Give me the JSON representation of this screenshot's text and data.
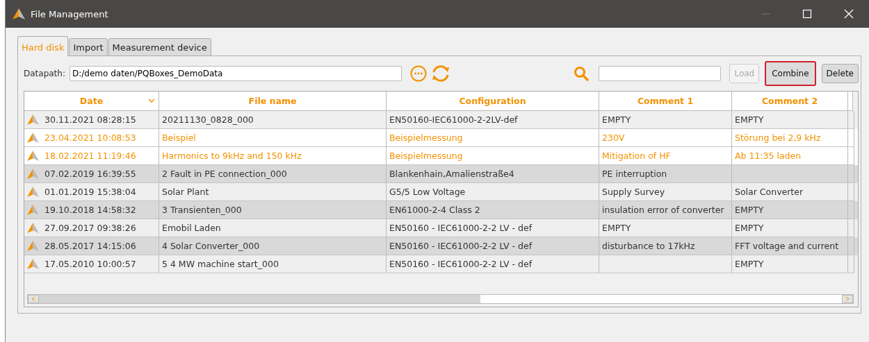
{
  "window": {
    "title": "File Management"
  },
  "tabs": [
    {
      "label": "Hard disk",
      "selected": true
    },
    {
      "label": "Import",
      "selected": false
    },
    {
      "label": "Measurement device",
      "selected": false
    }
  ],
  "datapath": {
    "label": "Datapath:",
    "value": "D:/demo daten/PQBoxes_DemoData"
  },
  "buttons": [
    {
      "label": "Load",
      "disabled": true,
      "highlighted": false
    },
    {
      "label": "Combine",
      "disabled": false,
      "highlighted": true
    },
    {
      "label": "Delete",
      "disabled": false,
      "highlighted": false
    }
  ],
  "table": {
    "columns": [
      {
        "label": "Date",
        "sorted": true
      },
      {
        "label": "File name",
        "sorted": false
      },
      {
        "label": "Configuration",
        "sorted": false
      },
      {
        "label": "Comment 1",
        "sorted": false
      },
      {
        "label": "Comment 2",
        "sorted": false
      }
    ],
    "rows": [
      {
        "selected": false,
        "cells": [
          "30.11.2021 08:28:15",
          "20211130_0828_000",
          "EN50160-IEC61000-2-2LV-def",
          "EMPTY",
          "EMPTY"
        ]
      },
      {
        "selected": true,
        "cells": [
          "23.04.2021 10:08:53",
          "Beispiel",
          "Beispielmessung",
          "230V",
          "Störung bei 2,9 kHz"
        ]
      },
      {
        "selected": true,
        "cells": [
          "18.02.2021 11:19:46",
          "Harmonics to 9kHz and 150 kHz",
          "Beispielmessung",
          "Mitigation of HF",
          "Ab 11:35 laden"
        ]
      },
      {
        "selected": false,
        "cells": [
          "07.02.2019 16:39:55",
          "2 Fault in PE connection_000",
          "Blankenhain,Amalienstraße4",
          "PE interruption",
          ""
        ]
      },
      {
        "selected": false,
        "cells": [
          "01.01.2019 15:38:04",
          "Solar Plant",
          "G5/5 Low Voltage",
          "Supply Survey",
          "Solar Converter"
        ]
      },
      {
        "selected": false,
        "cells": [
          "19.10.2018 14:58:32",
          "3 Transienten_000",
          "EN61000-2-4 Class 2",
          "insulation error of converter",
          "EMPTY"
        ]
      },
      {
        "selected": false,
        "cells": [
          "27.09.2017 09:38:26",
          "Emobil Laden",
          "EN50160 - IEC61000-2-2 LV - def",
          "EMPTY",
          "EMPTY"
        ]
      },
      {
        "selected": false,
        "cells": [
          "28.05.2017 14:15:06",
          "4 Solar Converter_000",
          "EN50160 - IEC61000-2-2 LV - def",
          "disturbance to 17kHz",
          "FFT voltage and current"
        ]
      },
      {
        "selected": false,
        "cells": [
          "17.05.2010 10:00:57",
          "5  4 MW machine start_000",
          "EN50160 - IEC61000-2-2 LV - def",
          "",
          "EMPTY"
        ]
      }
    ]
  }
}
